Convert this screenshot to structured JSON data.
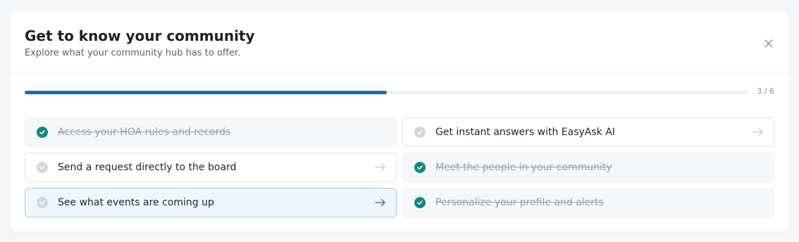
{
  "header": {
    "title": "Get to know your community",
    "subtitle": "Explore what your community hub has to offer."
  },
  "progress": {
    "completed": 3,
    "total": 6,
    "label": "3 / 6",
    "fill_color": "#1a6ab0"
  },
  "tasks": [
    {
      "label": "Access your HOA rules and records",
      "status": "done",
      "icon": "check-circle-icon"
    },
    {
      "label": "Get instant answers with EasyAsk AI",
      "status": "open",
      "icon": "check-circle-icon"
    },
    {
      "label": "Send a request directly to the board",
      "status": "open",
      "icon": "check-circle-icon"
    },
    {
      "label": "Meet the people in your community",
      "status": "done",
      "icon": "check-circle-icon"
    },
    {
      "label": "See what events are coming up",
      "status": "active",
      "icon": "check-circle-icon"
    },
    {
      "label": "Personalize your profile and alerts",
      "status": "done",
      "icon": "check-circle-icon"
    }
  ],
  "colors": {
    "done_check": "#12897b",
    "open_check": "#d4d7dc",
    "active_background": "#eef7fd",
    "active_border": "#9ccbe8",
    "arrow_active": "#1a6ab0"
  }
}
